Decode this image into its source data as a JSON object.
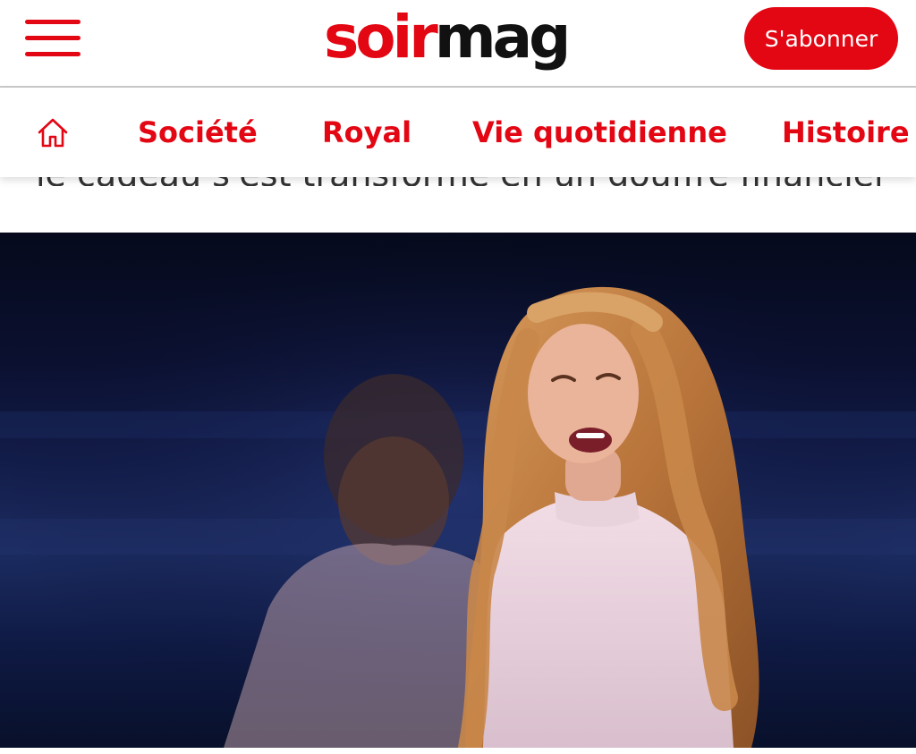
{
  "header": {
    "logo_part1": "soir",
    "logo_part2": "mag",
    "subscribe_label": "S'abonner"
  },
  "nav": {
    "items": [
      {
        "label": "Société"
      },
      {
        "label": "Royal"
      },
      {
        "label": "Vie quotidienne"
      },
      {
        "label": "Histoire"
      }
    ]
  },
  "article": {
    "partial_text": "le cadeau s'est transformé en un gouffre financier"
  },
  "icons": {
    "menu": "hamburger-menu-icon",
    "home": "home-icon"
  },
  "colors": {
    "brand_red": "#e30613",
    "logo_dark": "#111111"
  }
}
